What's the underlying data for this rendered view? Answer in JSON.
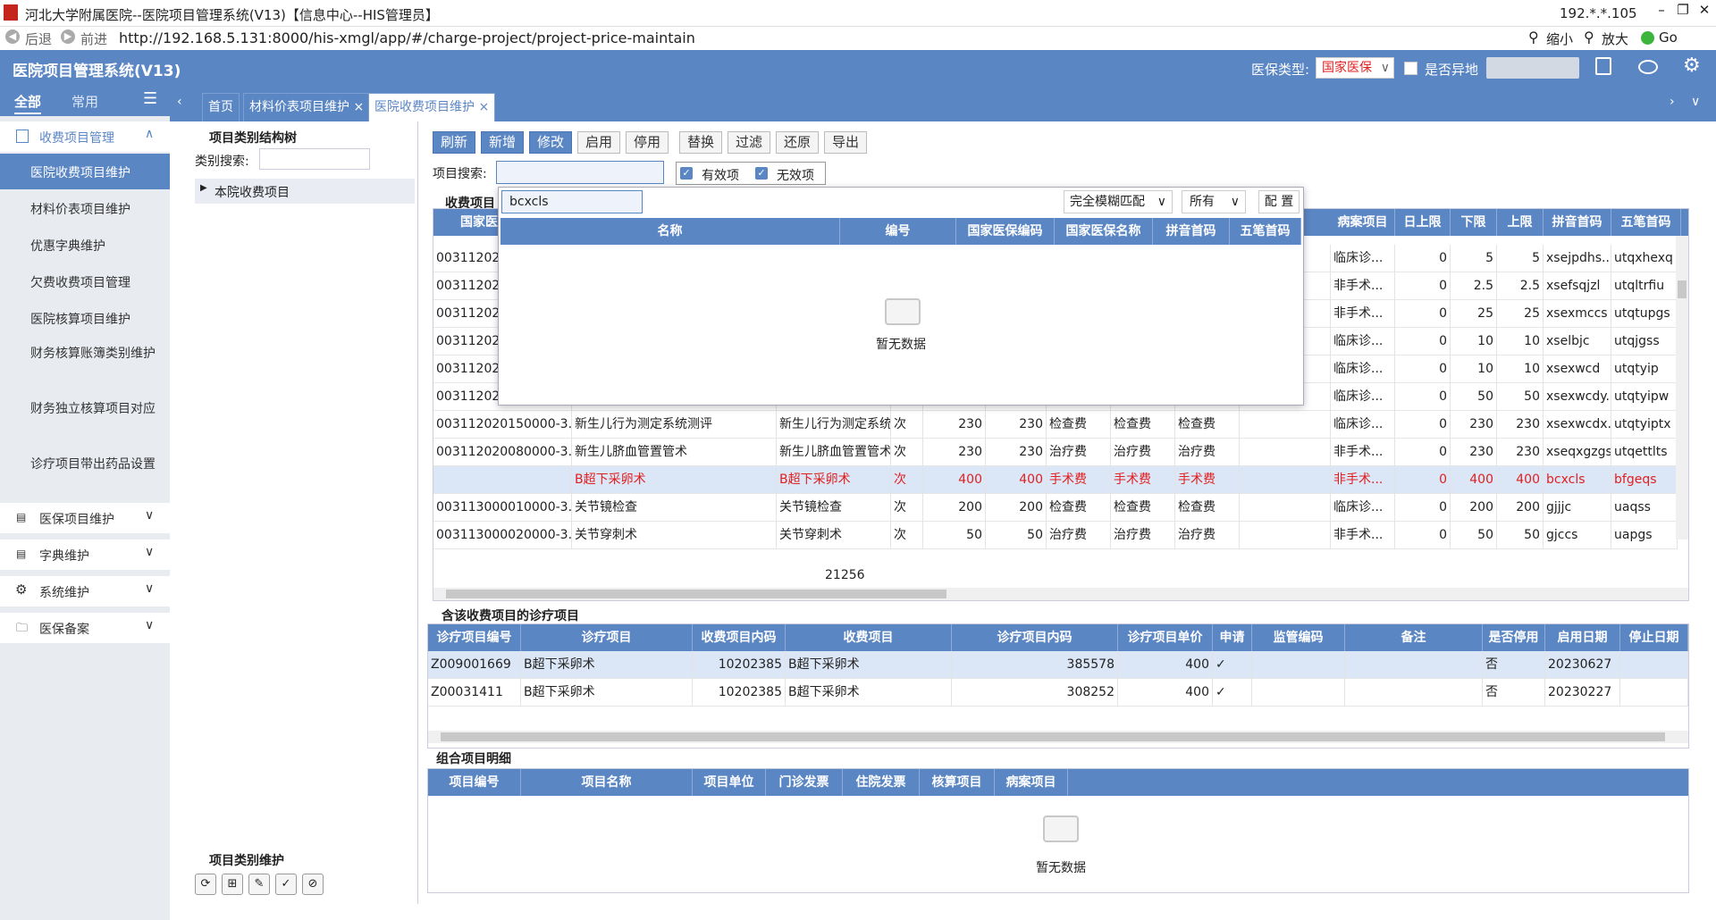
{
  "window": {
    "title": "河北大学附属医院--医院项目管理系统(V13)【信息中心--HIS管理员】",
    "ip": "192.*.*.105"
  },
  "browser": {
    "back_label": "后退",
    "forward_label": "前进",
    "url": "http://192.168.5.131:8000/his-xmgl/app/#/charge-project/project-price-maintain",
    "zoom_out_label": "缩小",
    "zoom_in_label": "放大",
    "go_label": "Go"
  },
  "header": {
    "app_name": "医院项目管理系统(V13)",
    "insurance_type_label": "医保类型:",
    "insurance_type_value": "国家医保",
    "remote_label": "是否异地"
  },
  "leftnav": {
    "tab_all": "全部",
    "tab_common": "常用",
    "groups": [
      {
        "label": "收费项目管理",
        "expanded": true,
        "items": [
          {
            "label": "医院收费项目维护",
            "active": true
          },
          {
            "label": "材料价表项目维护"
          },
          {
            "label": "优惠字典维护"
          },
          {
            "label": "欠费收费项目管理"
          },
          {
            "label": "医院核算项目维护"
          },
          {
            "label": "财务核算账簿类别维护"
          },
          {
            "label": "财务独立核算项目对应"
          },
          {
            "label": "诊疗项目带出药品设置"
          }
        ]
      },
      {
        "label": "医保项目维护"
      },
      {
        "label": "字典维护"
      },
      {
        "label": "系统维护"
      },
      {
        "label": "医保备案"
      }
    ]
  },
  "tabs": [
    {
      "label": "首页"
    },
    {
      "label": "材料价表项目维护",
      "closable": true
    },
    {
      "label": "医院收费项目维护",
      "closable": true,
      "active": true
    }
  ],
  "tree": {
    "title": "项目类别结构树",
    "search_label": "类别搜索:",
    "root_node": "本院收费项目",
    "maint_title": "项目类别维护"
  },
  "toolbar": {
    "buttons": [
      "刷新",
      "新增",
      "修改",
      "启用",
      "停用",
      "替换",
      "过滤",
      "还原",
      "导出"
    ]
  },
  "search": {
    "label": "项目搜索:",
    "valid_label": "有效项",
    "invalid_label": "无效项"
  },
  "charge_grid": {
    "title": "收费项目",
    "partial_header": "国家医",
    "headers_right": [
      "病案项目",
      "日上限",
      "下限",
      "上限",
      "拼音首码",
      "五笔首码"
    ],
    "rows": [
      {
        "code": "003112020",
        "c1": "",
        "c2": "",
        "c3": "",
        "c4": "",
        "c5": "",
        "c6": "",
        "c7": "",
        "c8": "",
        "c9": "",
        "blank": "",
        "case": "临床诊...",
        "day": "0",
        "low": "5",
        "high": "5",
        "py": "xsejpdhs...",
        "wb": "utqxhexq"
      },
      {
        "code": "003112020",
        "c1": "",
        "c2": "",
        "c3": "",
        "c4": "",
        "c5": "",
        "c6": "",
        "c7": "",
        "c8": "",
        "c9": "",
        "blank": "",
        "case": "非手术...",
        "day": "0",
        "low": "2.5",
        "high": "2.5",
        "py": "xsefsqjzl",
        "wb": "utqltrfiu"
      },
      {
        "code": "003112020",
        "c1": "",
        "c2": "",
        "c3": "",
        "c4": "",
        "c5": "",
        "c6": "",
        "c7": "",
        "c8": "",
        "c9": "",
        "blank": "",
        "case": "非手术...",
        "day": "0",
        "low": "25",
        "high": "25",
        "py": "xsexmccs",
        "wb": "utqtupgs"
      },
      {
        "code": "003112020",
        "c1": "",
        "c2": "",
        "c3": "",
        "c4": "",
        "c5": "",
        "c6": "",
        "c7": "",
        "c8": "",
        "c9": "",
        "blank": "",
        "case": "临床诊...",
        "day": "0",
        "low": "10",
        "high": "10",
        "py": "xselbjc",
        "wb": "utqjgss"
      },
      {
        "code": "003112020",
        "c1": "",
        "c2": "",
        "c3": "",
        "c4": "",
        "c5": "",
        "c6": "",
        "c7": "",
        "c8": "",
        "c9": "",
        "blank": "",
        "case": "临床诊...",
        "day": "0",
        "low": "10",
        "high": "10",
        "py": "xsexwcd",
        "wb": "utqtyip"
      },
      {
        "code": "003112020",
        "c1": "",
        "c2": "",
        "c3": "",
        "c4": "",
        "c5": "",
        "c6": "",
        "c7": "",
        "c8": "",
        "c9": "",
        "blank": "",
        "case": "临床诊...",
        "day": "0",
        "low": "50",
        "high": "50",
        "py": "xsexwcdy...",
        "wb": "utqtyipw"
      },
      {
        "code": "003112020150000-3...",
        "c1": "新生儿行为测定系统测评",
        "c2": "新生儿行为测定系统...",
        "c3": "次",
        "c4": "230",
        "c5": "230",
        "c6": "检查费",
        "c7": "检查费",
        "c8": "检查费",
        "case": "临床诊...",
        "day": "0",
        "low": "230",
        "high": "230",
        "py": "xsexwcdx...",
        "wb": "utqtyiptx"
      },
      {
        "code": "003112020080000-3...",
        "c1": "新生儿脐血管置管术",
        "c2": "新生儿脐血管置管术",
        "c3": "次",
        "c4": "230",
        "c5": "230",
        "c6": "治疗费",
        "c7": "治疗费",
        "c8": "治疗费",
        "case": "非手术...",
        "day": "0",
        "low": "230",
        "high": "230",
        "py": "xseqxgzgs",
        "wb": "utqettlts"
      },
      {
        "code": "",
        "c1": "B超下采卵术",
        "c2": "B超下采卵术",
        "c3": "次",
        "c4": "400",
        "c5": "400",
        "c6": "手术费",
        "c7": "手术费",
        "c8": "手术费",
        "case": "非手术...",
        "day": "0",
        "low": "400",
        "high": "400",
        "py": "bcxcls",
        "wb": "bfgeqs",
        "highlight": true
      },
      {
        "code": "003113000010000-3...",
        "c1": "关节镜检查",
        "c2": "关节镜检查",
        "c3": "次",
        "c4": "200",
        "c5": "200",
        "c6": "检查费",
        "c7": "检查费",
        "c8": "检查费",
        "case": "临床诊...",
        "day": "0",
        "low": "200",
        "high": "200",
        "py": "gjjjc",
        "wb": "uaqss"
      },
      {
        "code": "003113000020000-3...",
        "c1": "关节穿刺术",
        "c2": "关节穿刺术",
        "c3": "次",
        "c4": "50",
        "c5": "50",
        "c6": "治疗费",
        "c7": "治疗费",
        "c8": "治疗费",
        "case": "非手术...",
        "day": "0",
        "low": "50",
        "high": "50",
        "py": "gjccs",
        "wb": "uapgs"
      }
    ],
    "footer_total": "21256"
  },
  "popup": {
    "query": "bcxcls",
    "match_mode": "完全模糊匹配",
    "scope": "所有",
    "config_label": "配 置",
    "headers": [
      "名称",
      "编号",
      "国家医保编码",
      "国家医保名称",
      "拼音首码",
      "五笔首码"
    ],
    "empty_text": "暂无数据"
  },
  "treatment_grid": {
    "title": "含该收费项目的诊疗项目",
    "headers": [
      "诊疗项目编号",
      "诊疗项目",
      "收费项目内码",
      "收费项目",
      "诊疗项目内码",
      "诊疗项目单价",
      "申请",
      "监管编码",
      "备注",
      "是否停用",
      "启用日期",
      "停止日期"
    ],
    "rows": [
      {
        "code": "Z009001669",
        "name": "B超下采卵术",
        "charge_id": "10202385",
        "charge_name": "B超下采卵术",
        "inner": "385578",
        "price": "400",
        "apply": "✓",
        "reg": "",
        "note": "",
        "stop": "否",
        "start": "20230627",
        "end": ""
      },
      {
        "code": "Z00031411",
        "name": "B超下采卵术",
        "charge_id": "10202385",
        "charge_name": "B超下采卵术",
        "inner": "308252",
        "price": "400",
        "apply": "✓",
        "reg": "",
        "note": "",
        "stop": "否",
        "start": "20230227",
        "end": ""
      }
    ]
  },
  "combo_grid": {
    "title": "组合项目明细",
    "headers": [
      "项目编号",
      "项目名称",
      "项目单位",
      "门诊发票",
      "住院发票",
      "核算项目",
      "病案项目"
    ],
    "empty_text": "暂无数据"
  },
  "colors": {
    "accent": "#5b86c4",
    "highlight_row": "#dbe6f6",
    "danger": "#e02020"
  }
}
